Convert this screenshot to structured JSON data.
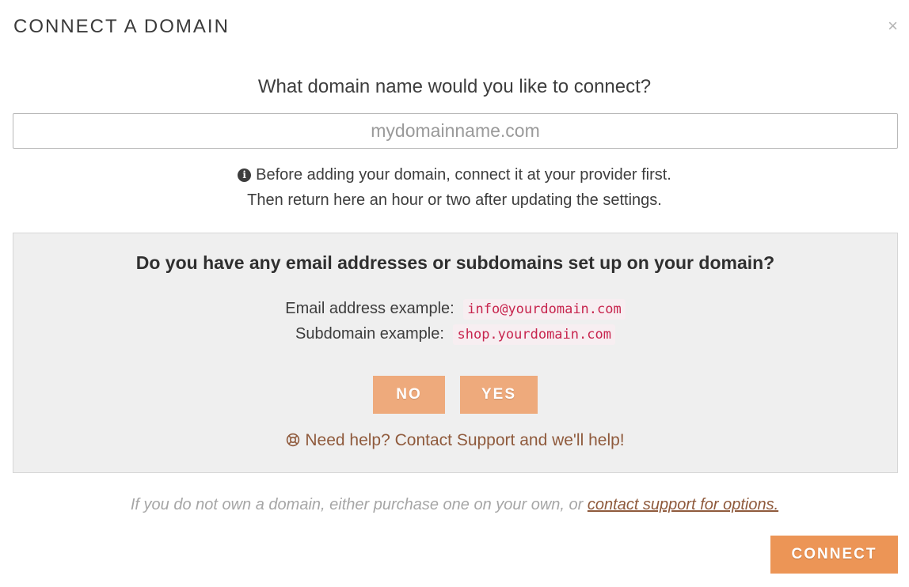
{
  "modal": {
    "title": "CONNECT A DOMAIN",
    "close_icon": "close-icon",
    "close_glyph": "×"
  },
  "domain_prompt": {
    "question": "What domain name would you like to connect?",
    "input_value": "",
    "input_placeholder": "mydomainname.com"
  },
  "info": {
    "icon": "info-icon",
    "icon_glyph": "i",
    "line1": "Before adding your domain, connect it at your provider first.",
    "line2": "Then return here an hour or two after updating the settings."
  },
  "email_panel": {
    "question": "Do you have any email addresses or subdomains set up on your domain?",
    "email_label": "Email address example:",
    "email_example": "info@yourdomain.com",
    "subdomain_label": "Subdomain example:",
    "subdomain_example": "shop.yourdomain.com",
    "no_label": "NO",
    "yes_label": "YES",
    "help_icon": "lifebuoy-icon",
    "help_text": "Need help? Contact Support and we'll help!"
  },
  "footer": {
    "note_text": "If you do not own a domain, either purchase one on your own, or",
    "link_text": "contact support for options."
  },
  "actions": {
    "connect_label": "CONNECT"
  },
  "colors": {
    "accent": "#ec9556",
    "accent_light": "#eeaa7c",
    "link": "#8f5a3c",
    "code": "#c7254e",
    "panel_bg": "#efefef"
  }
}
